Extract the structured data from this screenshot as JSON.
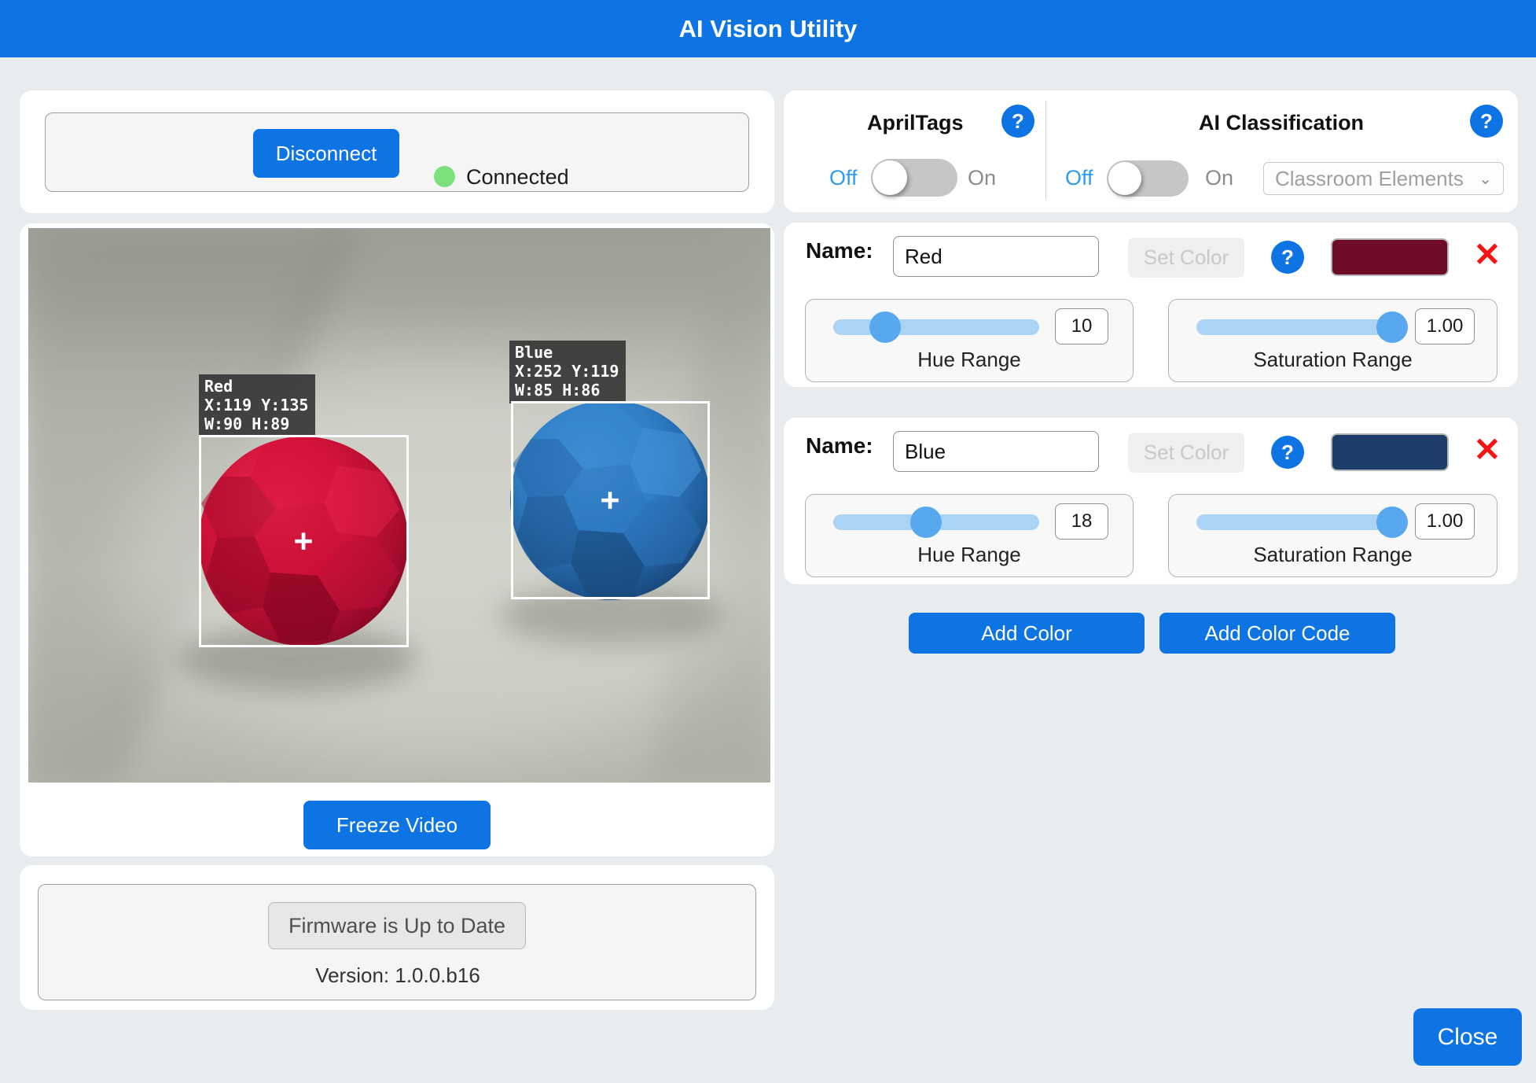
{
  "header": {
    "title": "AI Vision Utility"
  },
  "connection": {
    "disconnect_label": "Disconnect",
    "status_label": "Connected"
  },
  "video": {
    "freeze_button": "Freeze Video",
    "detections": [
      {
        "label": "Red",
        "position": "X:119 Y:135",
        "size": "W:90 H:89",
        "crosshair": "+"
      },
      {
        "label": "Blue",
        "position": "X:252 Y:119",
        "size": "W:85 H:86",
        "crosshair": "+"
      }
    ]
  },
  "firmware": {
    "status_button": "Firmware is Up to Date",
    "version": "Version: 1.0.0.b16"
  },
  "april_tags": {
    "title": "AprilTags",
    "help_icon": "?",
    "off_label": "Off",
    "on_label": "On",
    "state": "off"
  },
  "ai_classification": {
    "title": "AI Classification",
    "help_icon": "?",
    "off_label": "Off",
    "on_label": "On",
    "state": "off",
    "model_select": "Classroom Elements",
    "chevron_icon": "⌄"
  },
  "color_signatures": [
    {
      "name_label": "Name:",
      "name_value": "Red",
      "set_color_button": "Set Color",
      "help_icon": "?",
      "swatch_color": "#6e0c28",
      "delete_icon": "✕",
      "hue": {
        "value": "10",
        "label": "Hue Range",
        "slider_position": "25%"
      },
      "saturation": {
        "value": "1.00",
        "label": "Saturation Range",
        "slider_position": "95%"
      }
    },
    {
      "name_label": "Name:",
      "name_value": "Blue",
      "set_color_button": "Set Color",
      "help_icon": "?",
      "swatch_color": "#1d3e6b",
      "delete_icon": "✕",
      "hue": {
        "value": "18",
        "label": "Hue Range",
        "slider_position": "45%"
      },
      "saturation": {
        "value": "1.00",
        "label": "Saturation Range",
        "slider_position": "95%"
      }
    }
  ],
  "actions": {
    "add_color": "Add Color",
    "add_color_code": "Add Color Code",
    "close": "Close"
  }
}
